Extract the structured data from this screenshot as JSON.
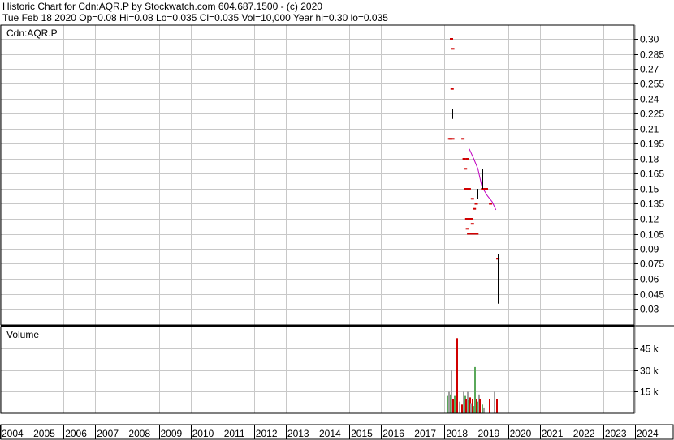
{
  "header": {
    "line1": "Historic Chart for Cdn:AQR.P by Stockwatch.com 604.687.1500 - (c) 2020",
    "line2": "Tue Feb 18 2020   Op=0.08   Hi=0.08   Lo=0.035   Cl=0.035   Vol=10,000   Year hi=0.30   lo=0.035"
  },
  "colors": {
    "grid": "#c8c8c8",
    "bar": "#000000",
    "drop": "#d00000",
    "average": "#c000c0",
    "vol_up": "#5aa85a",
    "vol_down": "#d00000",
    "vol_flat": "#a0a0a0"
  },
  "chart_data": [
    {
      "type": "line",
      "title": "Cdn:AQR.P",
      "ylim": [
        0.02,
        0.31
      ],
      "y_ticks": [
        "0.30",
        "0.285",
        "0.27",
        "0.255",
        "0.24",
        "0.225",
        "0.21",
        "0.195",
        "0.18",
        "0.165",
        "0.15",
        "0.135",
        "0.12",
        "0.105",
        "0.09",
        "0.075",
        "0.06",
        "0.045",
        "0.03"
      ],
      "x_ticks": [
        "2004",
        "2005",
        "2006",
        "2007",
        "2008",
        "2009",
        "2010",
        "2011",
        "2012",
        "2013",
        "2014",
        "2015",
        "2016",
        "2017",
        "2018",
        "2019",
        "2020",
        "2021",
        "2022",
        "2023",
        "2024"
      ],
      "price_bars": [
        {
          "t": 2018.25,
          "hi": 0.23,
          "lo": 0.22
        },
        {
          "t": 2019.03,
          "hi": 0.15,
          "lo": 0.14
        },
        {
          "t": 2019.18,
          "hi": 0.17,
          "lo": 0.15
        },
        {
          "t": 2019.67,
          "hi": 0.085,
          "lo": 0.035
        }
      ],
      "trades": [
        {
          "t": 2018.22,
          "v": 0.3
        },
        {
          "t": 2018.26,
          "v": 0.29
        },
        {
          "t": 2018.24,
          "v": 0.25
        },
        {
          "t": 2018.16,
          "v": 0.2
        },
        {
          "t": 2018.19,
          "v": 0.2
        },
        {
          "t": 2018.26,
          "v": 0.2
        },
        {
          "t": 2018.58,
          "v": 0.2
        },
        {
          "t": 2018.62,
          "v": 0.18
        },
        {
          "t": 2018.66,
          "v": 0.17
        },
        {
          "t": 2018.72,
          "v": 0.18
        },
        {
          "t": 2018.68,
          "v": 0.15
        },
        {
          "t": 2018.74,
          "v": 0.15
        },
        {
          "t": 2018.78,
          "v": 0.15
        },
        {
          "t": 2019.2,
          "v": 0.15
        },
        {
          "t": 2019.26,
          "v": 0.15
        },
        {
          "t": 2019.32,
          "v": 0.15
        },
        {
          "t": 2018.88,
          "v": 0.14
        },
        {
          "t": 2018.94,
          "v": 0.13
        },
        {
          "t": 2019.0,
          "v": 0.135
        },
        {
          "t": 2019.45,
          "v": 0.135
        },
        {
          "t": 2018.7,
          "v": 0.12
        },
        {
          "t": 2018.78,
          "v": 0.12
        },
        {
          "t": 2018.84,
          "v": 0.12
        },
        {
          "t": 2018.72,
          "v": 0.11
        },
        {
          "t": 2018.88,
          "v": 0.115
        },
        {
          "t": 2018.76,
          "v": 0.105
        },
        {
          "t": 2018.86,
          "v": 0.105
        },
        {
          "t": 2018.95,
          "v": 0.105
        },
        {
          "t": 2019.02,
          "v": 0.105
        },
        {
          "t": 2019.68,
          "v": 0.08
        }
      ],
      "moving_average": [
        {
          "t": 2018.78,
          "v": 0.19
        },
        {
          "t": 2018.92,
          "v": 0.18
        },
        {
          "t": 2019.05,
          "v": 0.17
        },
        {
          "t": 2019.18,
          "v": 0.152
        },
        {
          "t": 2019.35,
          "v": 0.143
        },
        {
          "t": 2019.5,
          "v": 0.137
        },
        {
          "t": 2019.62,
          "v": 0.129
        }
      ]
    },
    {
      "type": "bar",
      "title": "Volume",
      "ylim": [
        0,
        60000
      ],
      "y_ticks": [
        {
          "v": 45000,
          "label": "45 k"
        },
        {
          "v": 30000,
          "label": "30 k"
        },
        {
          "v": 15000,
          "label": "15 k"
        }
      ],
      "bars": [
        {
          "t": 2018.08,
          "v": 12000,
          "dir": "up"
        },
        {
          "t": 2018.12,
          "v": 15000,
          "dir": "flat"
        },
        {
          "t": 2018.16,
          "v": 13000,
          "dir": "up"
        },
        {
          "t": 2018.2,
          "v": 30000,
          "dir": "flat"
        },
        {
          "t": 2018.24,
          "v": 10000,
          "dir": "down"
        },
        {
          "t": 2018.3,
          "v": 12000,
          "dir": "up"
        },
        {
          "t": 2018.34,
          "v": 14000,
          "dir": "down"
        },
        {
          "t": 2018.38,
          "v": 52000,
          "dir": "down"
        },
        {
          "t": 2018.44,
          "v": 8000,
          "dir": "flat"
        },
        {
          "t": 2018.52,
          "v": 6000,
          "dir": "down"
        },
        {
          "t": 2018.58,
          "v": 15000,
          "dir": "flat"
        },
        {
          "t": 2018.62,
          "v": 12000,
          "dir": "up"
        },
        {
          "t": 2018.66,
          "v": 10000,
          "dir": "down"
        },
        {
          "t": 2018.7,
          "v": 15000,
          "dir": "flat"
        },
        {
          "t": 2018.74,
          "v": 9000,
          "dir": "up"
        },
        {
          "t": 2018.78,
          "v": 11000,
          "dir": "down"
        },
        {
          "t": 2018.82,
          "v": 7000,
          "dir": "flat"
        },
        {
          "t": 2018.86,
          "v": 10000,
          "dir": "down"
        },
        {
          "t": 2018.9,
          "v": 5000,
          "dir": "up"
        },
        {
          "t": 2018.94,
          "v": 32000,
          "dir": "up"
        },
        {
          "t": 2018.98,
          "v": 10000,
          "dir": "down"
        },
        {
          "t": 2019.02,
          "v": 8000,
          "dir": "up"
        },
        {
          "t": 2019.06,
          "v": 13000,
          "dir": "flat"
        },
        {
          "t": 2019.1,
          "v": 10000,
          "dir": "down"
        },
        {
          "t": 2019.16,
          "v": 6000,
          "dir": "up"
        },
        {
          "t": 2019.22,
          "v": 4000,
          "dir": "flat"
        },
        {
          "t": 2019.4,
          "v": 10000,
          "dir": "down"
        },
        {
          "t": 2019.56,
          "v": 15000,
          "dir": "flat"
        },
        {
          "t": 2019.62,
          "v": 10000,
          "dir": "down"
        }
      ]
    }
  ]
}
